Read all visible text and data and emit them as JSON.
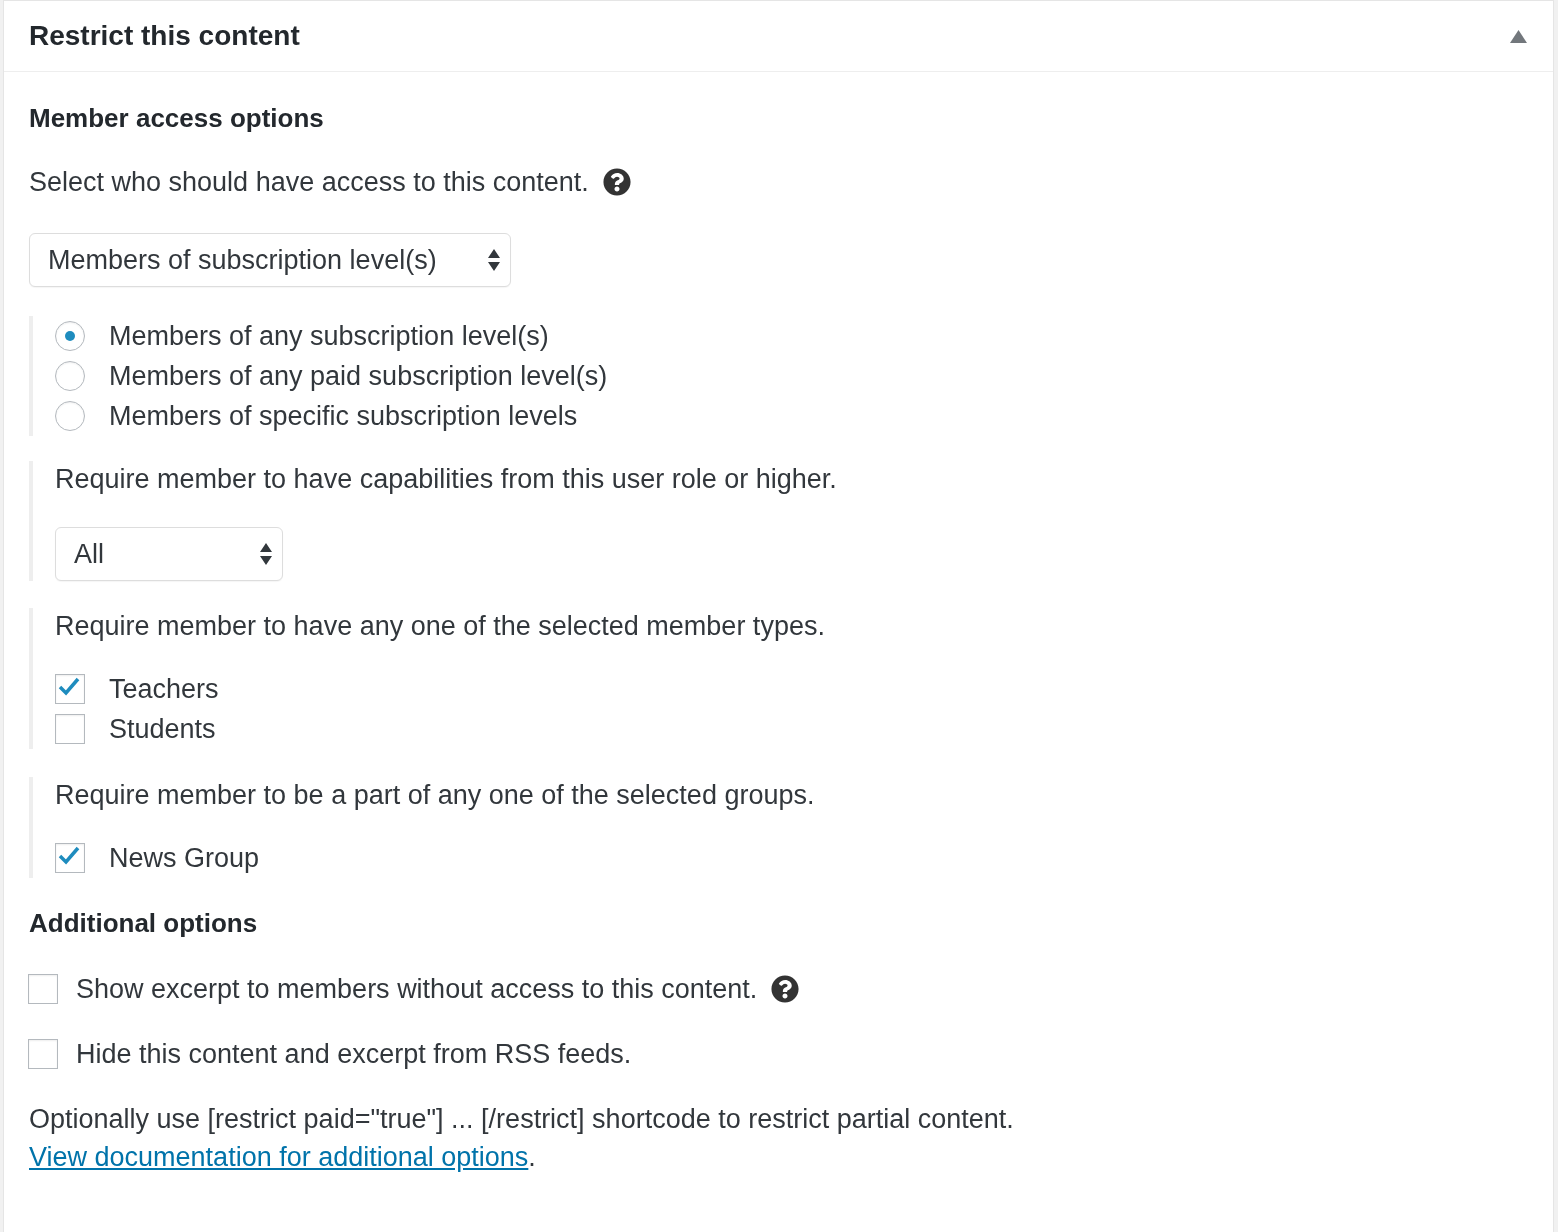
{
  "panel": {
    "title": "Restrict this content",
    "expanded": true
  },
  "member_access": {
    "heading": "Member access options",
    "description": "Select who should have access to this content.",
    "help": true,
    "access_select": {
      "value": "Members of subscription level(s)"
    },
    "level_options": [
      {
        "label": "Members of any subscription level(s)",
        "selected": true
      },
      {
        "label": "Members of any paid subscription level(s)",
        "selected": false
      },
      {
        "label": "Members of specific subscription levels",
        "selected": false
      }
    ]
  },
  "user_role": {
    "description": "Require member to have capabilities from this user role or higher.",
    "role_select": {
      "value": "All"
    }
  },
  "member_types": {
    "description": "Require member to have any one of the selected member types.",
    "items": [
      {
        "label": "Teachers",
        "checked": true
      },
      {
        "label": "Students",
        "checked": false
      }
    ]
  },
  "groups": {
    "description": "Require member to be a part of any one of the selected groups.",
    "items": [
      {
        "label": "News Group",
        "checked": true
      }
    ]
  },
  "additional_options": {
    "heading": "Additional options",
    "items": [
      {
        "label": "Show excerpt to members without access to this content.",
        "checked": false,
        "help": true
      },
      {
        "label": "Hide this content and excerpt from RSS feeds.",
        "checked": false,
        "help": false
      }
    ]
  },
  "shortcode_note": {
    "text": "Optionally use [restrict paid=\"true\"] ... [/restrict] shortcode to restrict partial content.",
    "link": "View documentation for additional options",
    "suffix": "."
  }
}
